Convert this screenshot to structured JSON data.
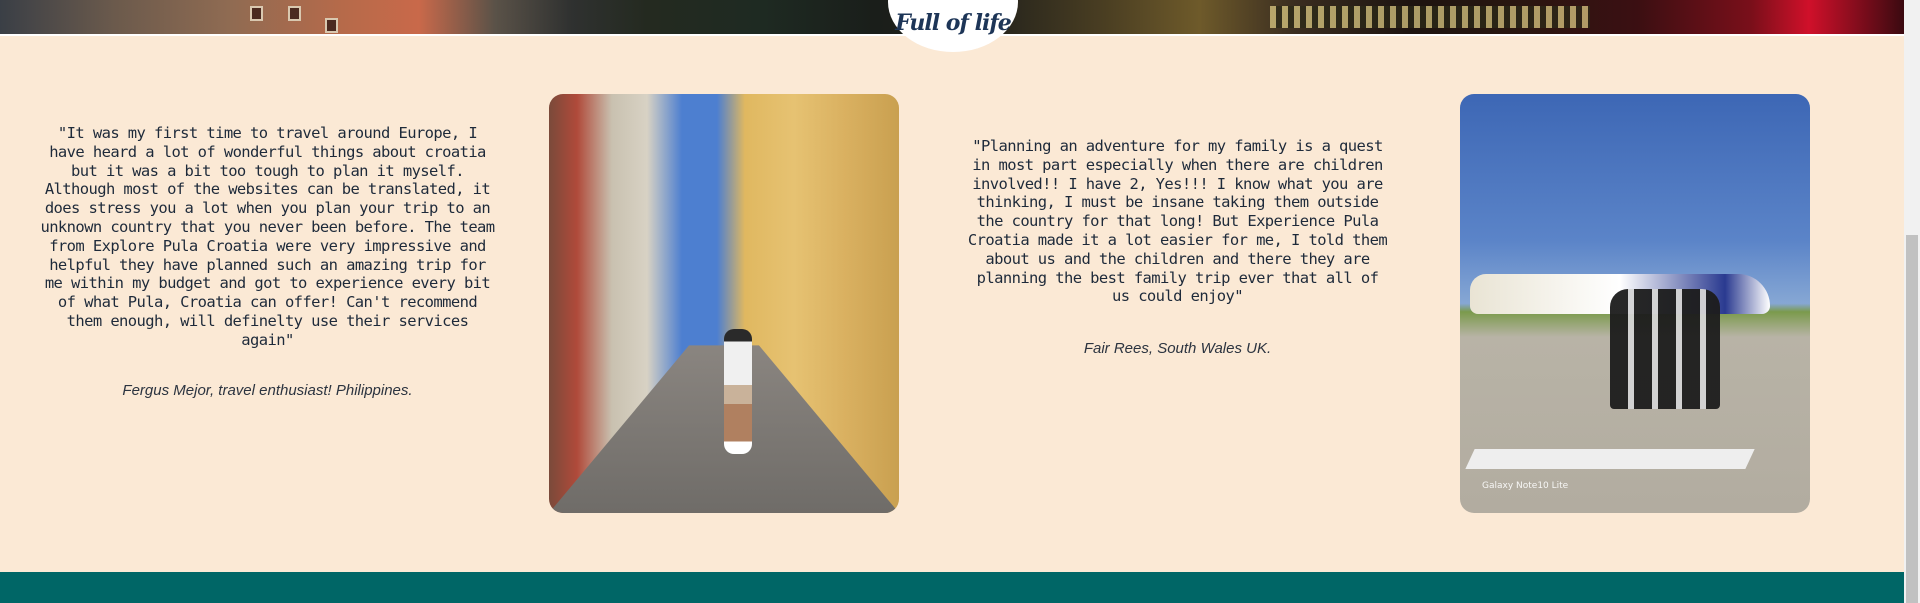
{
  "header": {
    "logo_text": "Full of life"
  },
  "testimonials": [
    {
      "quote": "\"It was my first time to travel around Europe, I have heard a lot of wonderful things about croatia but it was a bit too tough to plan it myself. Although most of the websites can be translated, it does stress you a lot when you plan your trip to an unknown country that you never been before. The team from Explore Pula Croatia were very impressive and helpful they have planned such an amazing trip for me within my budget and got to experience every bit of what Pula, Croatia can offer! Can't recommend them enough, will definelty use their services again\"",
      "author": "Fergus Mejor, travel enthusiast! Philippines."
    },
    {
      "quote": "\"Planning an adventure for my family is a quest in most part especially when there are children involved!! I have 2, Yes!!! I know what you are thinking, I must be insane taking them outside the country for that long! But Experience Pula Croatia made it a lot easier for me, I told them about us and the children and there they are planning the best family trip ever that all of us could enjoy\"",
      "author": "Fair Rees, South Wales UK."
    }
  ],
  "photos": {
    "photo2_caption": "Galaxy Note10 Lite"
  },
  "colors": {
    "background": "#fbe9d5",
    "footer": "#006666",
    "text": "#1e2a3a"
  }
}
